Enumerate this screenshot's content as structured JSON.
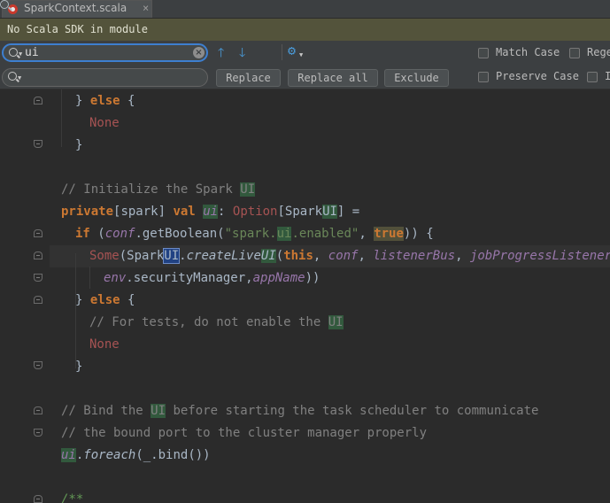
{
  "tab": {
    "title": "SparkContext.scala",
    "close_glyph": "×",
    "icon": "scala-file-icon"
  },
  "banner": {
    "text": "No Scala SDK in module"
  },
  "find": {
    "search_value": "ui",
    "replace_value": "",
    "clear_glyph": "×",
    "buttons": {
      "replace": "Replace",
      "replace_all": "Replace all",
      "exclude": "Exclude"
    },
    "options": {
      "match_case": "Match Case",
      "regex": "Rege",
      "preserve_case": "Preserve Case",
      "in_selection": "I"
    },
    "icons": [
      "search-icon",
      "previous-occurrence-icon",
      "next-occurrence-icon",
      "find-all-icon",
      "settings-gear-icon"
    ]
  },
  "colors": {
    "background": "#2b2b2b",
    "keyword": "#cc7832",
    "comment": "#808080",
    "string": "#6a8759",
    "field": "#9876aa",
    "match_highlight": "#32593d",
    "selected_match": "#214283",
    "banner": "#53533b"
  },
  "code": {
    "l1": {
      "a": "} ",
      "b": "else",
      "c": " {"
    },
    "l2": {
      "a": "None"
    },
    "l3": {
      "a": "}"
    },
    "l4": {
      "a": "// Initialize the Spark ",
      "b": "UI"
    },
    "l5": {
      "a": "private",
      "b": "[spark] ",
      "c": "val",
      "d": " ",
      "e": "ui",
      "f": ": ",
      "g": "Option",
      "h": "[Spark",
      "i": "UI",
      "j": "] ="
    },
    "l6": {
      "a": "if",
      "b": " (",
      "c": "conf",
      "d": ".getBoolean(",
      "e": "\"spark.",
      "f": "ui",
      "g": ".enabled\"",
      "h": ", ",
      "i": "true",
      "j": ")) {"
    },
    "l7": {
      "a": "Some",
      "b": "(Spark",
      "c": "UI",
      "d": ".",
      "e": "createLive",
      "f": "UI",
      "g": "(",
      "h": "this",
      "i": ", ",
      "j": "conf",
      "k": ", ",
      "l": "listenerBus",
      "m": ", ",
      "n": "jobProgressListener",
      "o": ","
    },
    "l8": {
      "a": "env",
      "b": ".securityManager,",
      "c": "appName",
      "d": "))"
    },
    "l9": {
      "a": "} ",
      "b": "else",
      "c": " {"
    },
    "l10": {
      "a": "// For tests, do not enable the ",
      "b": "UI"
    },
    "l11": {
      "a": "None"
    },
    "l12": {
      "a": "}"
    },
    "l13": {
      "a": "// Bind the ",
      "b": "UI",
      "c": " before starting the task scheduler to communicate"
    },
    "l14": {
      "a": "// the bound port to the cluster manager properly"
    },
    "l15": {
      "a": "ui",
      "b": ".",
      "c": "foreach",
      "d": "(_.bind())"
    },
    "l16": {
      "a": "/**"
    }
  }
}
